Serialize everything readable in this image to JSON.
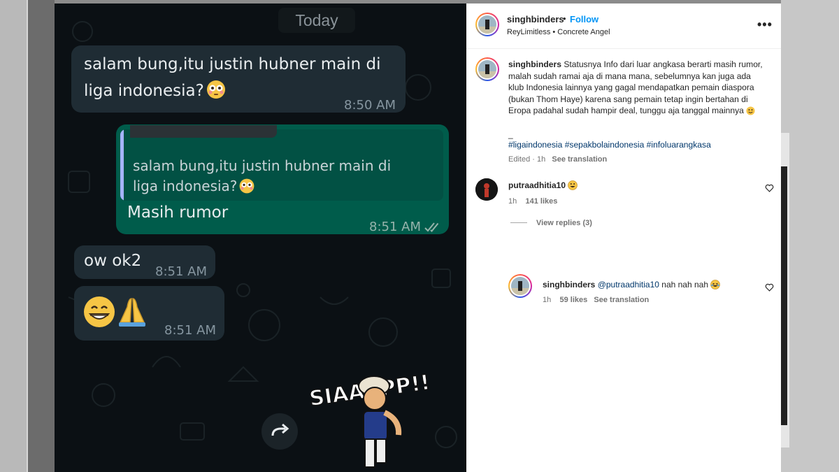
{
  "chat": {
    "date_label": "Today",
    "messages": [
      {
        "text": "salam bung,itu justin hubner main di liga indonesia?",
        "time": "8:50 AM"
      },
      {
        "quoted": "salam bung,itu justin hubner main di liga indonesia?",
        "text": "Masih rumor",
        "time": "8:51 AM"
      },
      {
        "text": "ow ok2",
        "time": "8:51 AM"
      },
      {
        "text": "",
        "time": "8:51 AM"
      }
    ],
    "sticker_text": "SIAAAPP!!"
  },
  "post": {
    "username": "singhbinders",
    "follow": "Follow",
    "audio": "ReyLimitless • Concrete Angel",
    "caption": "Statusnya Info dari luar angkasa berarti masih rumor, malah sudah ramai aja di mana mana, sebelumnya kan juga ada klub Indonesia lainnya yang gagal mendapatkan pemain diaspora (bukan Thom Haye) karena sang pemain tetap ingin bertahan di Eropa padahal sudah hampir deal, tunggu aja tanggal mainnya",
    "dash": "_",
    "hashtags": "#ligaindonesia #sepakbolaindonesia #infoluarangkasa",
    "edited": "Edited · 1h",
    "see_translation": "See translation"
  },
  "comments": [
    {
      "username": "putraadhitia10",
      "time": "1h",
      "likes": "141 likes",
      "view_replies": "View replies (3)"
    }
  ],
  "reply": {
    "username": "singhbinders",
    "mention": "@putraadhitia10",
    "text": "nah nah nah",
    "time": "1h",
    "likes": "59 likes",
    "see_translation": "See translation"
  },
  "icons": [
    "more-icon",
    "heart-icon",
    "forward-icon",
    "double-check-icon"
  ],
  "colors": {
    "follow": "#0095f6",
    "hashtag": "#00376b",
    "chat_out": "#005c4b",
    "chat_in": "#1f2c34"
  }
}
